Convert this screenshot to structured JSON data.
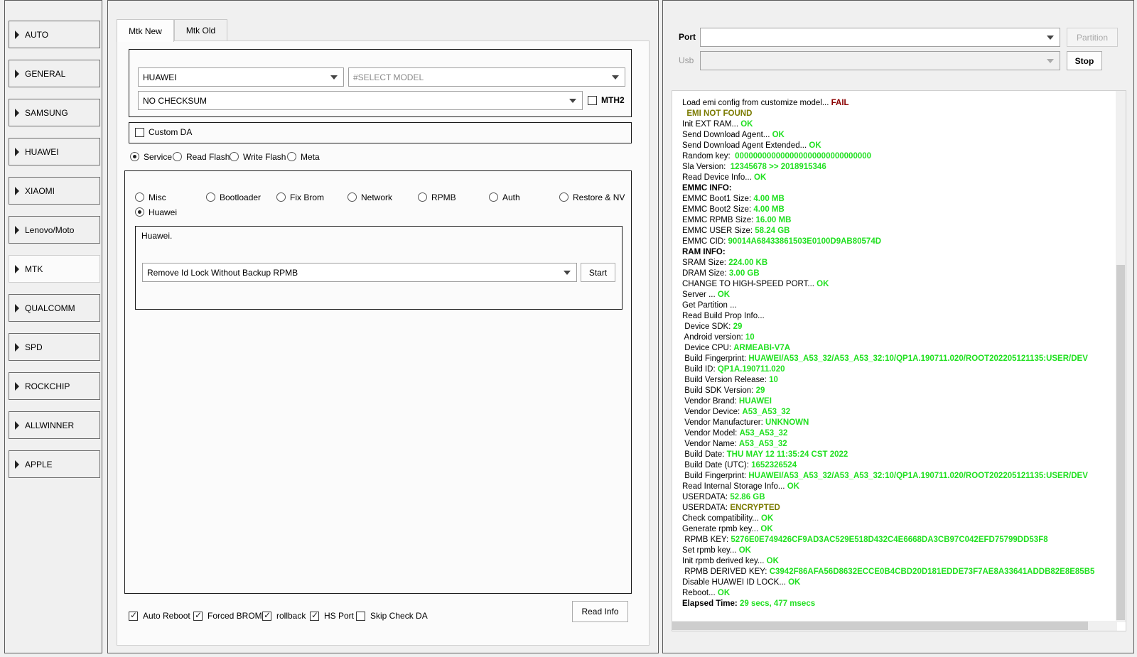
{
  "sidebar": {
    "items": [
      "AUTO",
      "GENERAL",
      "SAMSUNG",
      "HUAWEI",
      "XIAOMI",
      "Lenovo/Moto",
      "MTK",
      "QUALCOMM",
      "SPD",
      "ROCKCHIP",
      "ALLWINNER",
      "APPLE"
    ],
    "active": "MTK"
  },
  "tabs": {
    "new": "Mtk New",
    "old": "Mtk Old"
  },
  "device": {
    "brand": "HUAWEI",
    "model_placeholder": "#SELECT MODEL",
    "checksum": "NO CHECKSUM",
    "mth2_label": "MTH2",
    "custom_da_label": "Custom DA"
  },
  "modes": {
    "service": "Service",
    "read_flash": "Read Flash",
    "write_flash": "Write Flash",
    "meta": "Meta"
  },
  "service_options": {
    "misc": "Misc",
    "bootloader": "Bootloader",
    "fix_brom": "Fix Brom",
    "network": "Network",
    "rpmb": "RPMB",
    "auth": "Auth",
    "restore_nv": "Restore & NV",
    "huawei": "Huawei"
  },
  "huawei_box": {
    "title": "Huawei.",
    "operation": "Remove Id Lock  Without Backup RPMB",
    "start_label": "Start"
  },
  "bottom": {
    "auto_reboot": "Auto Reboot",
    "forced_brom": "Forced BROM",
    "rollback": "rollback",
    "hs_port": "HS Port",
    "skip_check_da": "Skip Check DA",
    "read_info": "Read Info"
  },
  "port": {
    "port_label": "Port",
    "usb_label": "Usb",
    "partition_label": "Partition",
    "stop_label": "Stop"
  },
  "log": [
    {
      "t": "Load emi config from customize model... ",
      "v": "FAIL",
      "c": "fail"
    },
    {
      "t": "  ",
      "v": "EMI NOT FOUND",
      "c": "olive"
    },
    {
      "t": "Init EXT RAM... ",
      "v": "OK",
      "c": "ok"
    },
    {
      "t": "Send Download Agent... ",
      "v": "OK",
      "c": "ok"
    },
    {
      "t": "Send Download Agent Extended... ",
      "v": "OK",
      "c": "ok"
    },
    {
      "t": "Random key:  ",
      "v": "000000000000000000000000000000",
      "c": "ok"
    },
    {
      "t": "Sla Version:  ",
      "v": "12345678  >> 2018915346",
      "c": "ok"
    },
    {
      "t": "Read Device Info... ",
      "v": "OK",
      "c": "ok"
    },
    {
      "t": "EMMC INFO:",
      "v": "",
      "c": "hdr"
    },
    {
      "t": "EMMC Boot1 Size: ",
      "v": "4.00 MB",
      "c": "ok"
    },
    {
      "t": "EMMC Boot2 Size: ",
      "v": "4.00 MB",
      "c": "ok"
    },
    {
      "t": "EMMC RPMB Size: ",
      "v": "16.00 MB",
      "c": "ok"
    },
    {
      "t": "EMMC USER Size: ",
      "v": "58.24 GB",
      "c": "ok"
    },
    {
      "t": "EMMC CID: ",
      "v": "90014A68433861503E0100D9AB80574D",
      "c": "ok"
    },
    {
      "t": "RAM INFO:",
      "v": "",
      "c": "hdr"
    },
    {
      "t": "SRAM Size: ",
      "v": "224.00 KB",
      "c": "ok"
    },
    {
      "t": "DRAM Size: ",
      "v": "3.00 GB",
      "c": "ok"
    },
    {
      "t": "CHANGE TO HIGH-SPEED PORT... ",
      "v": "OK",
      "c": "ok"
    },
    {
      "t": "Server ... ",
      "v": "OK",
      "c": "ok"
    },
    {
      "t": "Get Partition ...",
      "v": "",
      "c": ""
    },
    {
      "t": "Read Build Prop Info...",
      "v": "",
      "c": ""
    },
    {
      "t": " Device SDK: ",
      "v": "29",
      "c": "ok"
    },
    {
      "t": " Android version: ",
      "v": "10",
      "c": "ok"
    },
    {
      "t": " Device CPU: ",
      "v": "ARMEABI-V7A",
      "c": "ok"
    },
    {
      "t": " Build Fingerprint: ",
      "v": "HUAWEI/A53_A53_32/A53_A53_32:10/QP1A.190711.020/ROOT202205121135:USER/DEV",
      "c": "ok"
    },
    {
      "t": " Build ID: ",
      "v": "QP1A.190711.020",
      "c": "ok"
    },
    {
      "t": " Build Version Release: ",
      "v": "10",
      "c": "ok"
    },
    {
      "t": " Build SDK Version: ",
      "v": "29",
      "c": "ok"
    },
    {
      "t": " Vendor Brand: ",
      "v": "HUAWEI",
      "c": "ok"
    },
    {
      "t": " Vendor Device: ",
      "v": "A53_A53_32",
      "c": "ok"
    },
    {
      "t": " Vendor Manufacturer: ",
      "v": "UNKNOWN",
      "c": "ok"
    },
    {
      "t": " Vendor Model: ",
      "v": "A53_A53_32",
      "c": "ok"
    },
    {
      "t": " Vendor Name: ",
      "v": "A53_A53_32",
      "c": "ok"
    },
    {
      "t": " Build Date: ",
      "v": "THU MAY 12 11:35:24 CST 2022",
      "c": "ok"
    },
    {
      "t": " Build Date (UTC): ",
      "v": "1652326524",
      "c": "ok"
    },
    {
      "t": " Build Fingerprint: ",
      "v": "HUAWEI/A53_A53_32/A53_A53_32:10/QP1A.190711.020/ROOT202205121135:USER/DEV",
      "c": "ok"
    },
    {
      "t": "Read Internal Storage Info... ",
      "v": "OK",
      "c": "ok"
    },
    {
      "t": "USERDATA: ",
      "v": "52.86 GB",
      "c": "ok"
    },
    {
      "t": "USERDATA: ",
      "v": "ENCRYPTED",
      "c": "olive"
    },
    {
      "t": "Check compatibility... ",
      "v": "OK",
      "c": "ok"
    },
    {
      "t": "Generate rpmb key... ",
      "v": "OK",
      "c": "ok"
    },
    {
      "t": " RPMB KEY: ",
      "v": "5276E0E749426CF9AD3AC529E518D432C4E6668DA3CB97C042EFD75799DD53F8",
      "c": "ok"
    },
    {
      "t": "Set rpmb key... ",
      "v": "OK",
      "c": "ok"
    },
    {
      "t": "Init rpmb derived key... ",
      "v": "OK",
      "c": "ok"
    },
    {
      "t": " RPMB DERIVED KEY: ",
      "v": "C3942F86AFA56D8632ECCE0B4CBD20D181EDDE73F7AE8A33641ADDB82E8E85B5",
      "c": "ok"
    },
    {
      "t": "Disable HUAWEI ID LOCK... ",
      "v": "OK",
      "c": "ok"
    },
    {
      "t": "Reboot... ",
      "v": "OK",
      "c": "ok"
    },
    {
      "t": "Elapsed Time: ",
      "v": "29 secs, 477 msecs",
      "c": "ok",
      "bold_label": true
    }
  ]
}
